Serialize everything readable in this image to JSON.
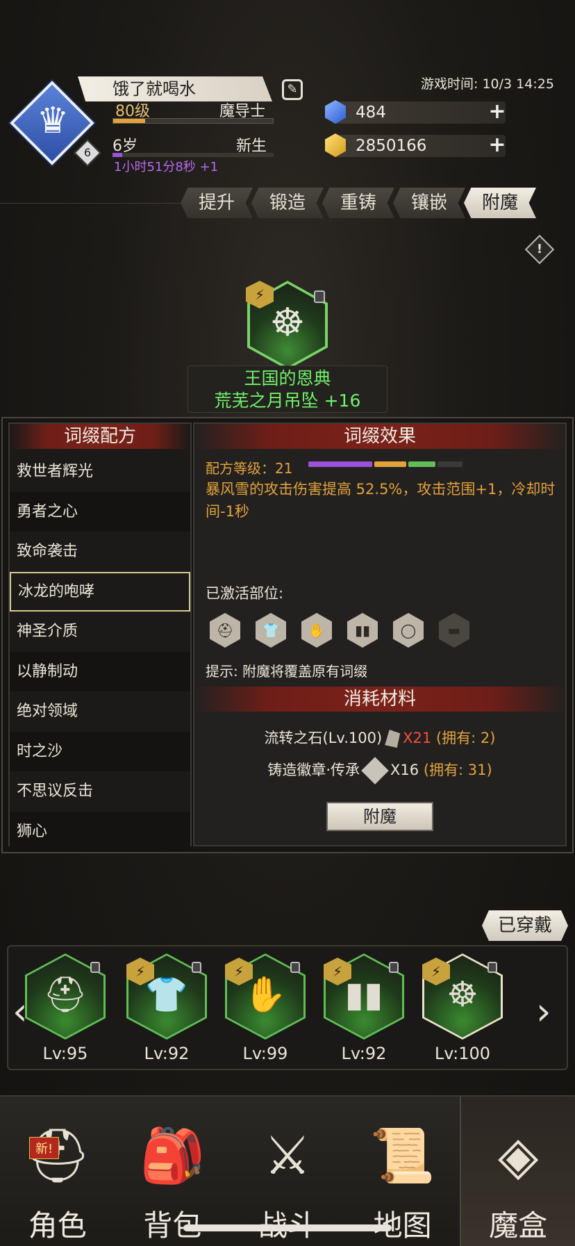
{
  "header": {
    "avatar_level": "6",
    "player_name": "饿了就喝水",
    "level": "80级",
    "class_name": "魔导士",
    "age": "6岁",
    "stage": "新生",
    "timer": "1小时51分8秒 +1",
    "game_time": "游戏时间: 10/3 14:25",
    "gems": "484",
    "gold": "2850166",
    "xp_progress": 0.2,
    "age_progress": 0.06
  },
  "tabs": [
    "提升",
    "锻造",
    "重铸",
    "镶嵌",
    "附魔"
  ],
  "active_tab": "附魔",
  "item": {
    "line1": "王国的恩典",
    "line2": "荒芜之月吊坠 +16"
  },
  "recipes": {
    "title": "词缀配方",
    "items": [
      "救世者辉光",
      "勇者之心",
      "致命袭击",
      "冰龙的咆哮",
      "神圣介质",
      "以静制动",
      "绝对领域",
      "时之沙",
      "不思议反击",
      "狮心"
    ],
    "selected": "冰龙的咆哮"
  },
  "effect": {
    "title": "词缀效果",
    "recipe_level": "配方等级：21",
    "description": "暴风雪的攻击伤害提高 52.5%，攻击范围+1，冷却时间-1秒",
    "active_slots_label": "已激活部位:",
    "slots": [
      "helmet-icon",
      "armor-icon",
      "glove-icon",
      "boots-icon",
      "ring-icon",
      "belt-icon"
    ],
    "hint": "提示: 附魔将覆盖原有词缀",
    "level_bar_colors": [
      "#9a53d6",
      "#e3a33a",
      "#5fbf55",
      "#3a3a3a"
    ]
  },
  "materials": {
    "title": "消耗材料",
    "mat1_name": "流转之石(Lv.100)",
    "mat1_qty": "X21",
    "mat1_owned": "(拥有: 2)",
    "mat2_name": "铸造徽章·传承",
    "mat2_qty": "X16",
    "mat2_owned": "(拥有: 31)",
    "button": "附魔"
  },
  "equipped": {
    "tag": "已穿戴",
    "items": [
      {
        "lv": "Lv:95",
        "icon": "helmet-icon"
      },
      {
        "lv": "Lv:92",
        "icon": "armor-icon"
      },
      {
        "lv": "Lv:99",
        "icon": "glove-icon"
      },
      {
        "lv": "Lv:92",
        "icon": "boots-icon"
      },
      {
        "lv": "Lv:100",
        "icon": "pendant-icon"
      }
    ]
  },
  "nav": {
    "items": [
      "角色",
      "背包",
      "战斗",
      "地图",
      "魔盒"
    ],
    "new_badge": "新!",
    "active": "魔盒"
  }
}
